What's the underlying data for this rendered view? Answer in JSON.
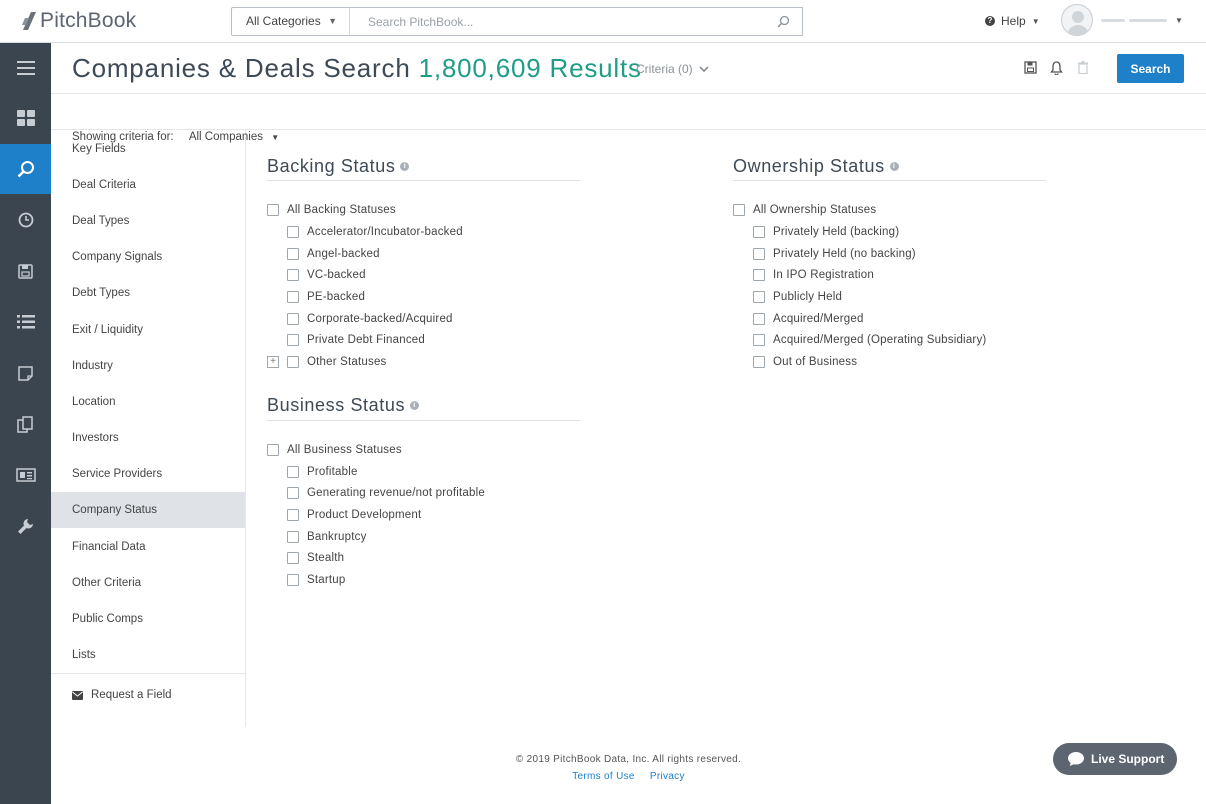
{
  "topbar": {
    "logo_text": "PitchBook",
    "category_select": "All Categories",
    "search_placeholder": "Search PitchBook...",
    "help_label": "Help"
  },
  "leftnav": {
    "items": [
      "menu-icon",
      "dashboard-icon",
      "search-icon",
      "clock-icon",
      "save-icon",
      "list-icon",
      "note-icon",
      "documents-icon",
      "news-icon",
      "wrench-icon"
    ],
    "active": "search-icon"
  },
  "header": {
    "title": "Companies & Deals Search",
    "results": "1,800,609 Results",
    "criteria_label": "Criteria (0)",
    "search_button": "Search"
  },
  "criteria_nav": {
    "showing_label": "Showing criteria for:",
    "showing_value": "All Companies",
    "items": [
      "Key Fields",
      "Deal Criteria",
      "Deal Types",
      "Company Signals",
      "Debt Types",
      "Exit / Liquidity",
      "Industry",
      "Location",
      "Investors",
      "Service Providers",
      "Company Status",
      "Financial Data",
      "Other Criteria",
      "Public Comps",
      "Lists"
    ],
    "active": "Company Status",
    "request_field": "Request a Field"
  },
  "backing_status": {
    "title": "Backing Status",
    "all_label": "All Backing Statuses",
    "options": [
      "Accelerator/Incubator-backed",
      "Angel-backed",
      "VC-backed",
      "PE-backed",
      "Corporate-backed/Acquired",
      "Private Debt Financed",
      "Other Statuses"
    ]
  },
  "business_status": {
    "title": "Business Status",
    "all_label": "All Business Statuses",
    "options": [
      "Profitable",
      "Generating revenue/not profitable",
      "Product Development",
      "Bankruptcy",
      "Stealth",
      "Startup"
    ]
  },
  "ownership_status": {
    "title": "Ownership Status",
    "all_label": "All Ownership Statuses",
    "options": [
      "Privately Held (backing)",
      "Privately Held (no backing)",
      "In IPO Registration",
      "Publicly Held",
      "Acquired/Merged",
      "Acquired/Merged (Operating Subsidiary)",
      "Out of Business"
    ]
  },
  "footer": {
    "copyright": "© 2019 PitchBook Data, Inc. All rights reserved.",
    "terms": "Terms of Use",
    "privacy": "Privacy"
  },
  "live_support": "Live Support",
  "colors": {
    "accent": "#1e80c8",
    "results_green": "#1f9e87",
    "sidebar_dark": "#3a4550"
  }
}
